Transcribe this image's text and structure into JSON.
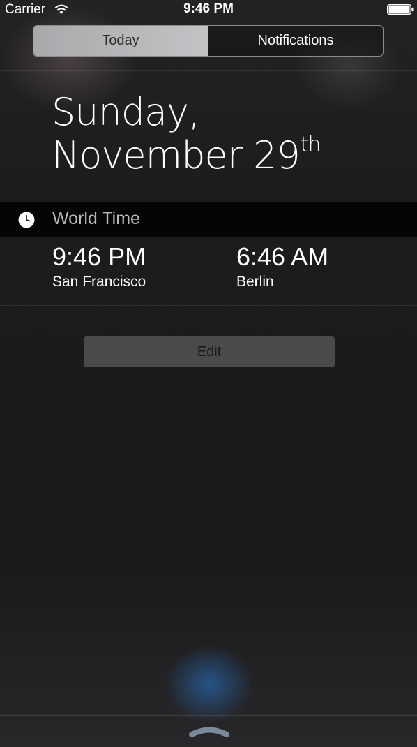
{
  "status_bar": {
    "carrier": "Carrier",
    "time": "9:46 PM",
    "icons": [
      "wifi-icon",
      "battery-icon"
    ]
  },
  "segmented_control": {
    "tabs": [
      {
        "label": "Today",
        "selected": true
      },
      {
        "label": "Notifications",
        "selected": false
      }
    ]
  },
  "date": {
    "weekday": "Sunday,",
    "month_day": "November 29",
    "suffix": "th"
  },
  "widget": {
    "icon": "clock-icon",
    "title": "World Time",
    "clocks": [
      {
        "time": "9:46 PM",
        "city": "San Francisco"
      },
      {
        "time": "6:46 AM",
        "city": "Berlin"
      }
    ]
  },
  "edit_button": {
    "label": "Edit"
  },
  "grabber": {
    "icon": "chevron-up-grabber-icon"
  },
  "colors": {
    "background": "#1b1b1c",
    "segment_selected": "#b8b7ba",
    "widget_header": "#050506",
    "edit_button": "#4a4a4c",
    "glow": "#2864aa"
  }
}
